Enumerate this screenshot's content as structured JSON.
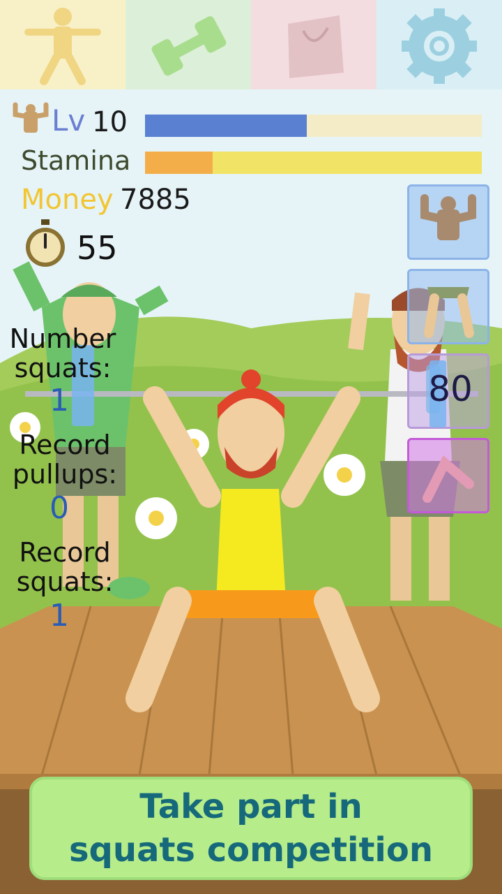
{
  "tabs": [
    {
      "name": "character-tab",
      "icon": "stick-figure-icon",
      "bg": "#f8f1c8"
    },
    {
      "name": "training-tab",
      "icon": "dumbbell-icon",
      "bg": "#dcefd8"
    },
    {
      "name": "shop-tab",
      "icon": "shopping-bag-icon",
      "bg": "#f4dde0"
    },
    {
      "name": "settings-tab",
      "icon": "gear-icon",
      "bg": "#d9eef5"
    }
  ],
  "hud": {
    "level_label": "Lv",
    "level_value": "10",
    "level_progress": 0.48,
    "stamina_label": "Stamina",
    "stamina_progress": 0.2,
    "money_label": "Money",
    "money_value": "7885",
    "timer_value": "55"
  },
  "stats": {
    "number_squats_label": "Number squats:",
    "number_squats_value": "1",
    "record_pullups_label": "Record pullups:",
    "record_pullups_value": "0",
    "record_squats_label": "Record squats:",
    "record_squats_value": "1"
  },
  "counter_value": "80",
  "side_buttons": [
    {
      "name": "pullups-exercise-button",
      "icon": "flexing-arms-icon"
    },
    {
      "name": "legs-exercise-button",
      "icon": "legs-icon"
    },
    {
      "name": "squats-exercise-button",
      "icon": "squat-icon"
    },
    {
      "name": "stretch-exercise-button",
      "icon": "stretching-icon"
    }
  ],
  "bottom_button": {
    "line1": "Take part in",
    "line2": "squats competition"
  },
  "colors": {
    "level_fill": "#5a80d1",
    "level_track": "#f3ecc6",
    "stamina_fill": "#f3ae49",
    "stamina_track": "#f0e366",
    "bottom_button": "#b6ec8a"
  }
}
